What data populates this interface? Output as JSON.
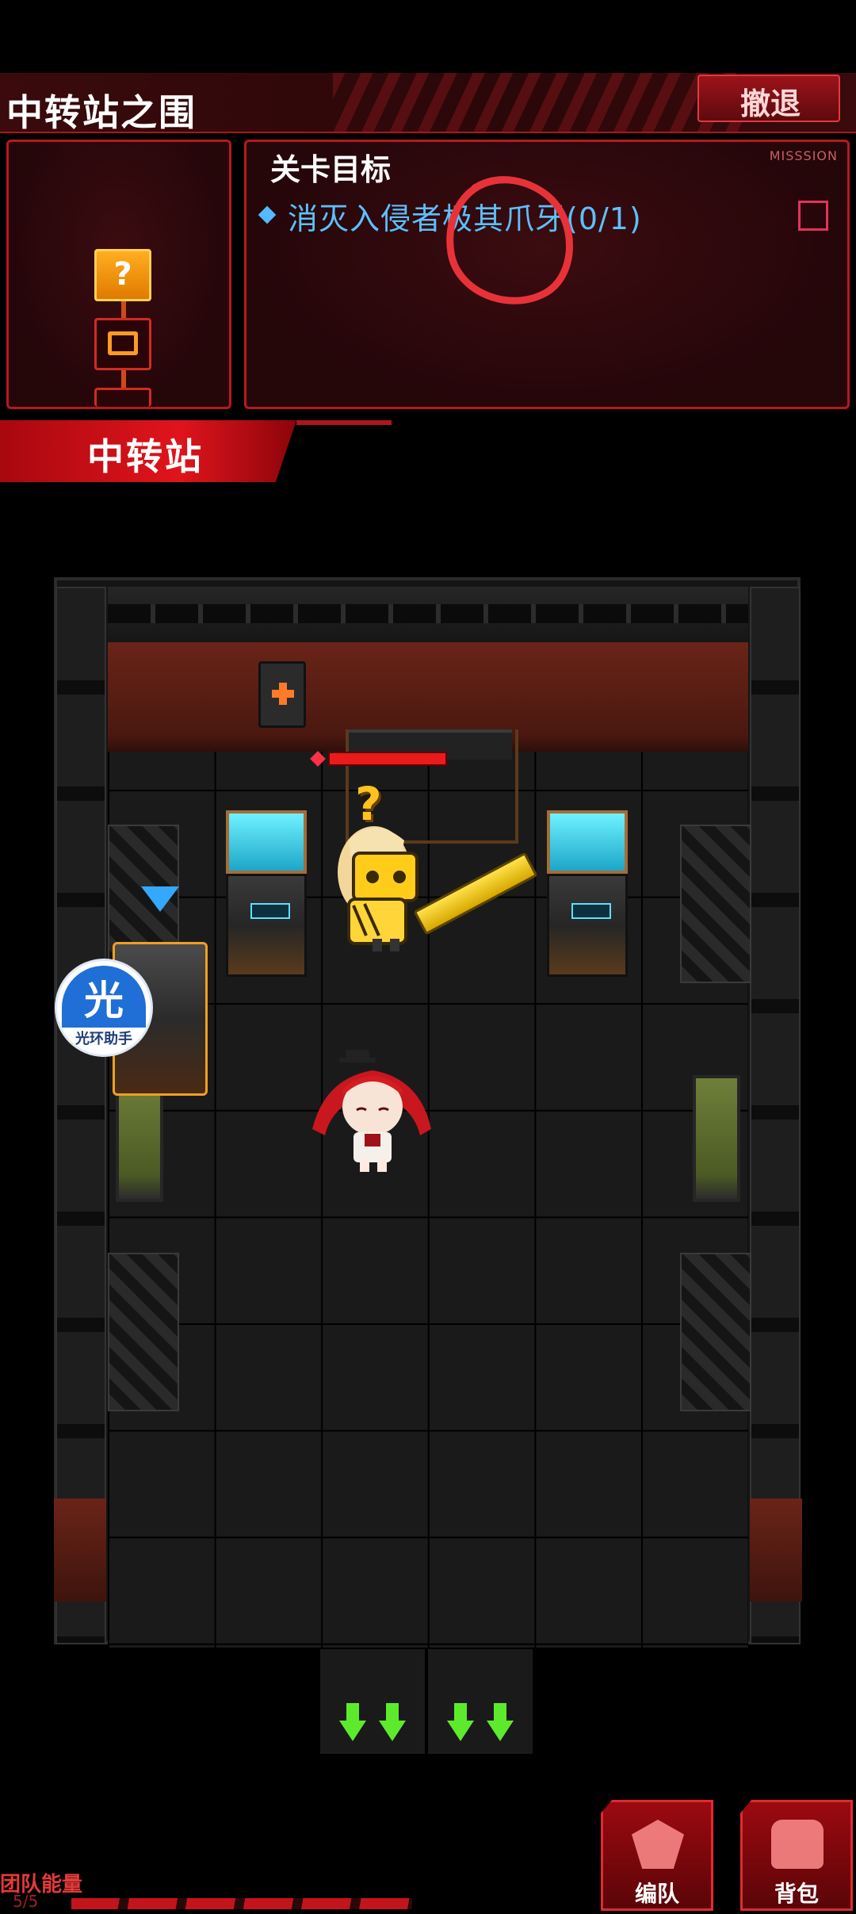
{
  "header": {
    "stage_title": "中转站之围",
    "retreat_label": "撤退"
  },
  "minimap": {
    "nodes": [
      {
        "type": "unknown",
        "glyph": "?"
      },
      {
        "type": "chest",
        "glyph": ""
      },
      {
        "type": "next",
        "glyph": ""
      }
    ]
  },
  "mission": {
    "title": "关卡目标",
    "tag": "MISSSION",
    "objective": "消灭入侵者极其爪牙(0/1)",
    "completed": false
  },
  "stage_banner": {
    "label": "中转站"
  },
  "enemy": {
    "hp_fraction": 1.0,
    "status_glyph": "?"
  },
  "assist_button": {
    "glyph": "光",
    "label": "光环助手"
  },
  "hud": {
    "energy_label": "团队能量",
    "energy_count": "5/5",
    "team_button_label": "编队",
    "bag_button_label": "背包"
  },
  "colors": {
    "accent_red": "#e0141c",
    "objective_blue": "#5cc0ff",
    "exit_arrow_green": "#5eea2c",
    "question_yellow": "#ffc21e"
  }
}
